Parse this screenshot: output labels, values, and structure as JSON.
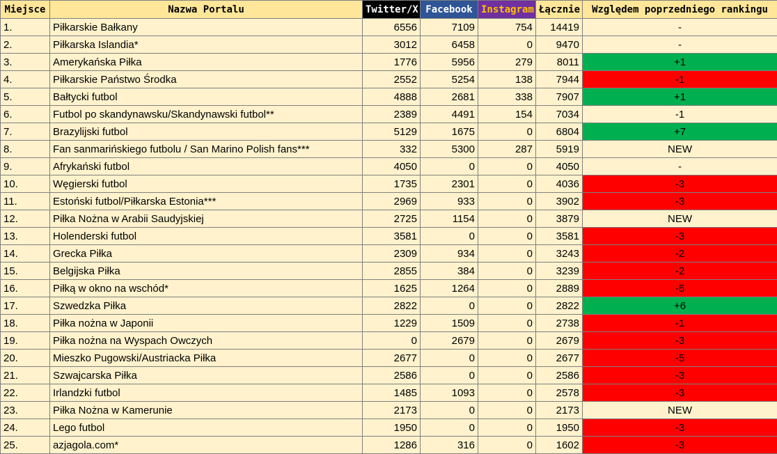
{
  "colors": {
    "cell_bg": "#fff2cc",
    "header_bg": "#ffe699",
    "twitter_header_bg": "#000000",
    "facebook_header_bg": "#2f5597",
    "instagram_header_bg": "#7030a0",
    "instagram_header_text": "#ffc000",
    "increase": "#00b050",
    "decrease": "#ff0000"
  },
  "headers": {
    "place": "Miejsce",
    "name": "Nazwa Portalu",
    "twitter": "Twitter/X",
    "facebook": "Facebook",
    "instagram": "Instagram",
    "total": "Łącznie",
    "change": "Względem poprzedniego rankingu"
  },
  "rows": [
    {
      "place": "1.",
      "name": "Piłkarskie Bałkany",
      "twitter": "6556",
      "facebook": "7109",
      "instagram": "754",
      "total": "14419",
      "change": "-",
      "trend": "neutral"
    },
    {
      "place": "2.",
      "name": "Piłkarska Islandia*",
      "twitter": "3012",
      "facebook": "6458",
      "instagram": "0",
      "total": "9470",
      "change": "-",
      "trend": "neutral"
    },
    {
      "place": "3.",
      "name": "Amerykańska Piłka",
      "twitter": "1776",
      "facebook": "5956",
      "instagram": "279",
      "total": "8011",
      "change": "+1",
      "trend": "up"
    },
    {
      "place": "4.",
      "name": "Piłkarskie Państwo Środka",
      "twitter": "2552",
      "facebook": "5254",
      "instagram": "138",
      "total": "7944",
      "change": "-1",
      "trend": "down"
    },
    {
      "place": "5.",
      "name": "Bałtycki futbol",
      "twitter": "4888",
      "facebook": "2681",
      "instagram": "338",
      "total": "7907",
      "change": "+1",
      "trend": "up"
    },
    {
      "place": "6.",
      "name": "Futbol po skandynawsku/Skandynawski futbol**",
      "twitter": "2389",
      "facebook": "4491",
      "instagram": "154",
      "total": "7034",
      "change": "-1",
      "trend": "neutral"
    },
    {
      "place": "7.",
      "name": "Brazylijski futbol",
      "twitter": "5129",
      "facebook": "1675",
      "instagram": "0",
      "total": "6804",
      "change": "+7",
      "trend": "up"
    },
    {
      "place": "8.",
      "name": "Fan sanmarińskiego futbolu / San Marino Polish fans***",
      "twitter": "332",
      "facebook": "5300",
      "instagram": "287",
      "total": "5919",
      "change": "NEW",
      "trend": "neutral"
    },
    {
      "place": "9.",
      "name": "Afrykański futbol",
      "twitter": "4050",
      "facebook": "0",
      "instagram": "0",
      "total": "4050",
      "change": "-",
      "trend": "neutral"
    },
    {
      "place": "10.",
      "name": "Węgierski futbol",
      "twitter": "1735",
      "facebook": "2301",
      "instagram": "0",
      "total": "4036",
      "change": "-3",
      "trend": "down"
    },
    {
      "place": "11.",
      "name": "Estoński futbol/Piłkarska Estonia***",
      "twitter": "2969",
      "facebook": "933",
      "instagram": "0",
      "total": "3902",
      "change": "-3",
      "trend": "down"
    },
    {
      "place": "12.",
      "name": "Piłka Nożna w Arabii Saudyjskiej",
      "twitter": "2725",
      "facebook": "1154",
      "instagram": "0",
      "total": "3879",
      "change": "NEW",
      "trend": "neutral"
    },
    {
      "place": "13.",
      "name": "Holenderski futbol",
      "twitter": "3581",
      "facebook": "0",
      "instagram": "0",
      "total": "3581",
      "change": "-3",
      "trend": "down"
    },
    {
      "place": "14.",
      "name": "Grecka Piłka",
      "twitter": "2309",
      "facebook": "934",
      "instagram": "0",
      "total": "3243",
      "change": "-2",
      "trend": "down"
    },
    {
      "place": "15.",
      "name": "Belgijska Piłka",
      "twitter": "2855",
      "facebook": "384",
      "instagram": "0",
      "total": "3239",
      "change": "-2",
      "trend": "down"
    },
    {
      "place": "16.",
      "name": "Piłką w okno na wschód*",
      "twitter": "1625",
      "facebook": "1264",
      "instagram": "0",
      "total": "2889",
      "change": "-5",
      "trend": "down"
    },
    {
      "place": "17.",
      "name": "Szwedzka Piłka",
      "twitter": "2822",
      "facebook": "0",
      "instagram": "0",
      "total": "2822",
      "change": "+6",
      "trend": "up"
    },
    {
      "place": "18.",
      "name": "Piłka nożna w Japonii",
      "twitter": "1229",
      "facebook": "1509",
      "instagram": "0",
      "total": "2738",
      "change": "-1",
      "trend": "down"
    },
    {
      "place": "19.",
      "name": "Piłka nożna na Wyspach Owczych",
      "twitter": "0",
      "facebook": "2679",
      "instagram": "0",
      "total": "2679",
      "change": "-3",
      "trend": "down"
    },
    {
      "place": "20.",
      "name": "Mieszko Pugowski/Austriacka Piłka",
      "twitter": "2677",
      "facebook": "0",
      "instagram": "0",
      "total": "2677",
      "change": "-5",
      "trend": "down"
    },
    {
      "place": "21.",
      "name": "Szwajcarska Piłka",
      "twitter": "2586",
      "facebook": "0",
      "instagram": "0",
      "total": "2586",
      "change": "-3",
      "trend": "down"
    },
    {
      "place": "22.",
      "name": "Irlandzki futbol",
      "twitter": "1485",
      "facebook": "1093",
      "instagram": "0",
      "total": "2578",
      "change": "-3",
      "trend": "down"
    },
    {
      "place": "23.",
      "name": "Piłka Nożna w Kamerunie",
      "twitter": "2173",
      "facebook": "0",
      "instagram": "0",
      "total": "2173",
      "change": "NEW",
      "trend": "neutral"
    },
    {
      "place": "24.",
      "name": "Lego futbol",
      "twitter": "1950",
      "facebook": "0",
      "instagram": "0",
      "total": "1950",
      "change": "-3",
      "trend": "down"
    },
    {
      "place": "25.",
      "name": "azjagola.com*",
      "twitter": "1286",
      "facebook": "316",
      "instagram": "0",
      "total": "1602",
      "change": "-3",
      "trend": "down"
    }
  ]
}
